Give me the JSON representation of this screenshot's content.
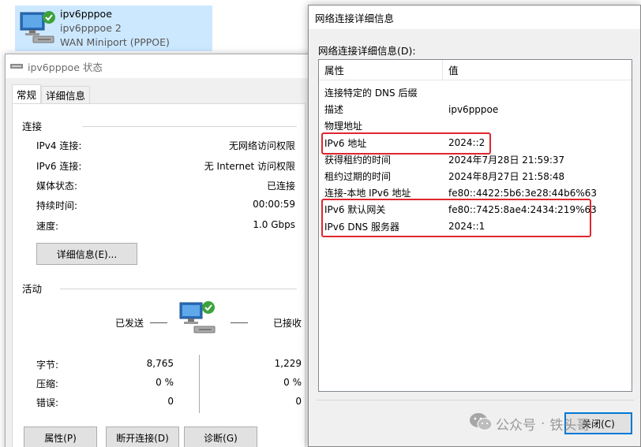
{
  "connection_tile": {
    "name": "ipv6pppoe",
    "subname": "ipv6pppoe 2",
    "device": "WAN Miniport (PPPOE)"
  },
  "status_window": {
    "title": "ipv6pppoe 状态",
    "tabs": [
      "常规",
      "详细信息"
    ],
    "connection_group": "连接",
    "rows": [
      {
        "label": "IPv4 连接:",
        "value": "无网络访问权限"
      },
      {
        "label": "IPv6 连接:",
        "value": "无 Internet 访问权限"
      },
      {
        "label": "媒体状态:",
        "value": "已连接"
      },
      {
        "label": "持续时间:",
        "value": "00:00:59"
      },
      {
        "label": "速度:",
        "value": "1.0 Gbps"
      }
    ],
    "details_button": "详细信息(E)...",
    "activity_group": "活动",
    "sent_label": "已发送",
    "received_label": "已接收",
    "stats": [
      {
        "label": "字节:",
        "sent": "8,765",
        "received": "1,229"
      },
      {
        "label": "压缩:",
        "sent": "0 %",
        "received": "0 %"
      },
      {
        "label": "错误:",
        "sent": "0",
        "received": "0"
      }
    ],
    "buttons": {
      "properties": "属性(P)",
      "disconnect": "断开连接(D)",
      "diagnose": "诊断(G)"
    }
  },
  "details_window": {
    "title": "网络连接详细信息",
    "list_caption": "网络连接详细信息(D):",
    "columns": [
      "属性",
      "值"
    ],
    "rows": [
      {
        "prop": "连接特定的 DNS 后缀",
        "value": ""
      },
      {
        "prop": "描述",
        "value": "ipv6pppoe"
      },
      {
        "prop": "物理地址",
        "value": ""
      },
      {
        "prop": "IPv6 地址",
        "value": "2024::2"
      },
      {
        "prop": "获得租约的时间",
        "value": "2024年7月28日 21:59:37"
      },
      {
        "prop": "租约过期的时间",
        "value": "2024年8月27日 21:58:48"
      },
      {
        "prop": "连接-本地 IPv6 地址",
        "value": "fe80::4422:5b6:3e28:44b6%63"
      },
      {
        "prop": "IPv6 默认网关",
        "value": "fe80::7425:8ae4:2434:219%63"
      },
      {
        "prop": "IPv6 DNS 服务器",
        "value": "2024::1"
      }
    ],
    "close_button": "关闭(C)",
    "highlight_color": "#e0262e"
  },
  "watermark": {
    "text": "公众号",
    "author": "铁头哥"
  }
}
